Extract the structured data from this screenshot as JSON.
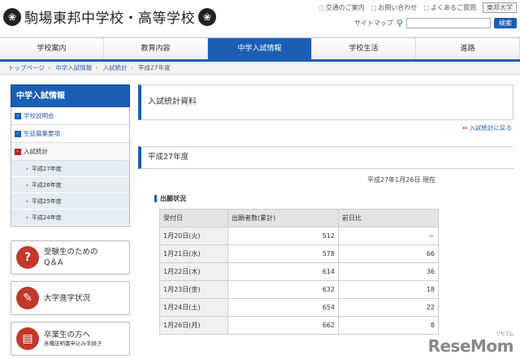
{
  "header": {
    "crest_left": "❀",
    "crest_right": "❀",
    "title": "駒場東邦中学校・高等学校",
    "top_links": [
      "交通のご案内",
      "お問い合わせ",
      "よくあるご質問"
    ],
    "univ": "東邦大学",
    "sitemap": "サイトマップ",
    "search_button": "検索"
  },
  "nav": [
    "学校案内",
    "教育内容",
    "中学入試情報",
    "学校生活",
    "進路"
  ],
  "breadcrumb": [
    "トップページ",
    "中学入試情報",
    "入試統計",
    "平成27年度"
  ],
  "sidebar": {
    "title": "中学入試情報",
    "items": [
      "学校説明会",
      "生徒募集要項",
      "入試統計"
    ],
    "subitems": [
      "平成27年度",
      "平成26年度",
      "平成25年度",
      "平成24年度"
    ]
  },
  "banners": [
    {
      "icon": "?",
      "line1": "受験生のための",
      "line2": "Q＆A",
      "small": ""
    },
    {
      "icon": "✎",
      "line1": "大学進学状況",
      "line2": "",
      "small": ""
    },
    {
      "icon": "▤",
      "line1": "卒業生の方へ",
      "line2": "",
      "small": "各種証明書申込み手続き"
    }
  ],
  "main": {
    "title": "入試統計資料",
    "back_link": "入試統計に戻る",
    "year": "平成27年度",
    "as_of": "平成27年1月26日 現在",
    "section": "出願状況",
    "table": {
      "headers": [
        "受付日",
        "出願者数(累計)",
        "前日比"
      ],
      "rows": [
        [
          "1月20日(火)",
          "512",
          "－"
        ],
        [
          "1月21日(水)",
          "578",
          "66"
        ],
        [
          "1月22日(木)",
          "614",
          "36"
        ],
        [
          "1月23日(金)",
          "632",
          "18"
        ],
        [
          "1月24日(土)",
          "654",
          "22"
        ],
        [
          "1月26日(月)",
          "662",
          "8"
        ]
      ]
    }
  },
  "watermark": {
    "text": "ReseMom",
    "sub": "リセマム"
  }
}
